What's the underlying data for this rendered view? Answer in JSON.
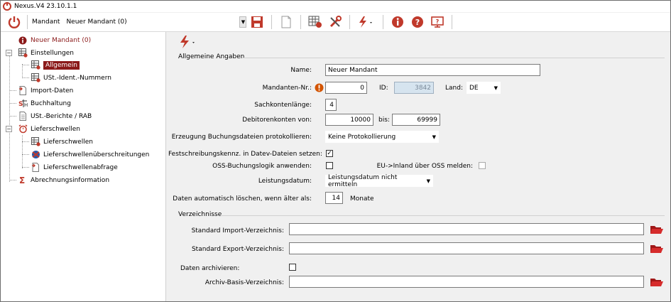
{
  "window": {
    "title": "Nexus.V4 23.10.1.1"
  },
  "toolbar": {
    "mandant_label": "Mandant",
    "mandant_value": "Neuer Mandant (0)"
  },
  "sidebar": {
    "items": [
      {
        "label": "Neuer Mandant (0)"
      },
      {
        "label": "Einstellungen"
      },
      {
        "label": "Allgemein"
      },
      {
        "label": "USt.-Ident.-Nummern"
      },
      {
        "label": "Import-Daten"
      },
      {
        "label": "Buchhaltung"
      },
      {
        "label": "USt.-Berichte / RAB"
      },
      {
        "label": "Lieferschwellen"
      },
      {
        "label": "Lieferschwellen"
      },
      {
        "label": "Lieferschwellenüberschreitungen"
      },
      {
        "label": "Lieferschwellenabfrage"
      },
      {
        "label": "Abrechnungsinformation"
      }
    ]
  },
  "allgemein": {
    "group_title": "Allgemeine Angaben",
    "name_label": "Name:",
    "name_value": "Neuer Mandant",
    "mandanten_nr_label": "Mandanten-Nr.:",
    "mandanten_nr_value": "0",
    "id_label": "ID:",
    "id_value": "3842",
    "land_label": "Land:",
    "land_value": "DE",
    "sachkonten_label": "Sachkontenlänge:",
    "sachkonten_value": "4",
    "debitoren_label": "Debitorenkonten von:",
    "debitoren_from": "10000",
    "bis_label": "bis:",
    "debitoren_to": "69999",
    "protokoll_label": "Erzeugung Buchungsdateien protokollieren:",
    "protokoll_value": "Keine Protokollierung",
    "festschreibung_label": "Festschreibungskennz. in Datev-Dateien setzen:",
    "festschreibung_checked": "✓",
    "oss_label": "OSS-Buchungslogik anwenden:",
    "eu_inland_label": "EU->Inland über OSS melden:",
    "leistungsdatum_label": "Leistungsdatum:",
    "leistungsdatum_value": "Leistungsdatum nicht ermitteln",
    "loeschen_label": "Daten automatisch löschen, wenn älter als:",
    "loeschen_value": "14",
    "monate_label": "Monate"
  },
  "verzeichnisse": {
    "group_title": "Verzeichnisse",
    "import_label": "Standard Import-Verzeichnis:",
    "import_value": "",
    "export_label": "Standard Export-Verzeichnis:",
    "export_value": "",
    "archivieren_label": "Daten archivieren:",
    "archiv_label": "Archiv-Basis-Verzeichnis:",
    "archiv_value": ""
  },
  "colors": {
    "accent": "#8b1a1a",
    "icon_red": "#c0392b"
  }
}
